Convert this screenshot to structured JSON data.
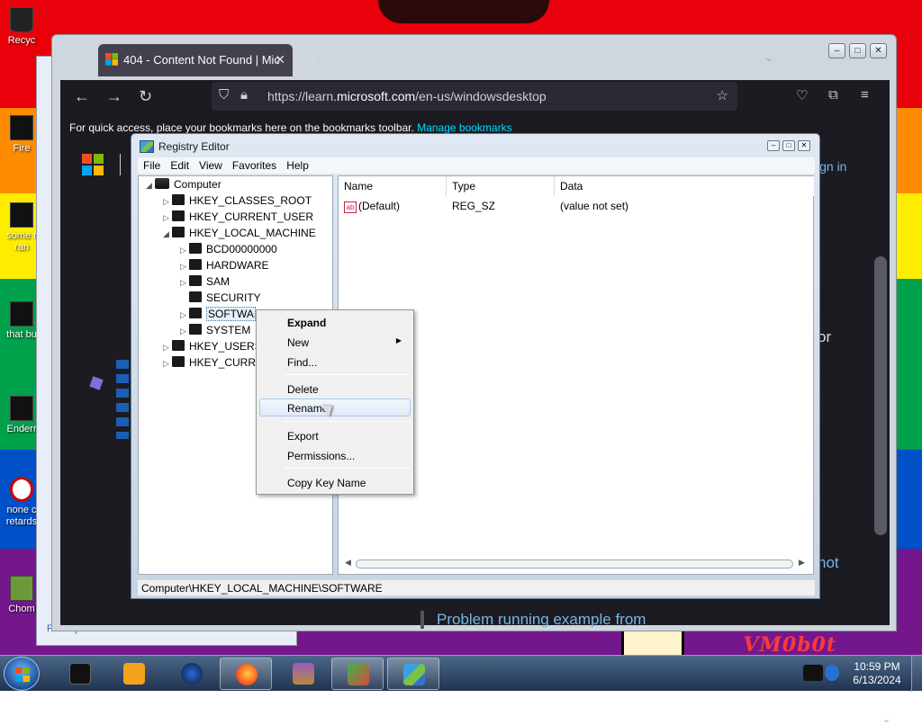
{
  "desktop": {
    "icons": [
      {
        "label": "Recyc",
        "icon": "recycle-bin-icon"
      },
      {
        "label": "Fire",
        "icon": "firefox-shortcut-icon"
      },
      {
        "label": "some r ran",
        "icon": "file-icon"
      },
      {
        "label": "that bu",
        "icon": "file-icon"
      },
      {
        "label": "Enderr",
        "icon": "app-icon"
      },
      {
        "label": "none c retards",
        "icon": "app-icon"
      },
      {
        "label": "Chom",
        "icon": "app-icon"
      }
    ],
    "watermark": "VM0b0t",
    "bg_window_footer": "Privacy statement   Server status"
  },
  "browser": {
    "tab_title": "404 - Content Not Found | Mic",
    "tab_close": "✕",
    "new_tab": "+",
    "url_prefix": "https://learn.",
    "url_host": "microsoft.com",
    "url_suffix": "/en-us/windowsdesktop",
    "bookmarks_text": "For quick access, place your bookmarks here on the bookmarks toolbar.",
    "bookmarks_link": "Manage bookmarks",
    "page": {
      "signin": "ign in",
      "fragment_or": "or",
      "fragment_not": "not",
      "problem_link": "Problem running example from"
    }
  },
  "registry": {
    "title": "Registry Editor",
    "menu": [
      "File",
      "Edit",
      "View",
      "Favorites",
      "Help"
    ],
    "tree": {
      "root": "Computer",
      "hives": [
        "HKEY_CLASSES_ROOT",
        "HKEY_CURRENT_USER",
        "HKEY_LOCAL_MACHINE"
      ],
      "hklm_children": [
        "BCD00000000",
        "HARDWARE",
        "SAM",
        "SECURITY",
        "SOFTWA",
        "SYSTEM"
      ],
      "after": [
        "HKEY_USERS",
        "HKEY_CURRE"
      ]
    },
    "columns": {
      "name": "Name",
      "type": "Type",
      "data": "Data"
    },
    "rows": [
      {
        "name": "(Default)",
        "type": "REG_SZ",
        "data": "(value not set)"
      }
    ],
    "status": "Computer\\HKEY_LOCAL_MACHINE\\SOFTWARE"
  },
  "context_menu": {
    "expand": "Expand",
    "new": "New",
    "find": "Find...",
    "delete": "Delete",
    "rename": "Rename",
    "export": "Export",
    "permissions": "Permissions...",
    "copy_key": "Copy Key Name"
  },
  "taskbar": {
    "time": "10:59 PM",
    "date": "6/13/2024",
    "buttons": [
      "terminal-icon",
      "media-player-icon",
      "globe-icon",
      "firefox-icon",
      "winrar-icon",
      "network-users-icon",
      "registry-editor-icon"
    ]
  }
}
